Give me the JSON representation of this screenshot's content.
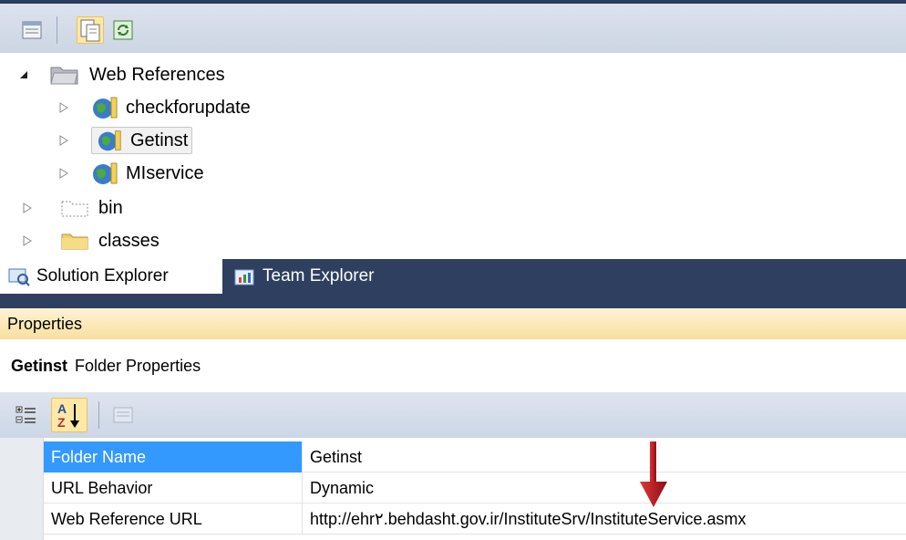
{
  "toolbar": {
    "buttons": [
      {
        "icon": "properties-view-icon",
        "active": false
      },
      {
        "icon": "show-all-files-icon",
        "active": true
      },
      {
        "icon": "refresh-icon",
        "active": false
      }
    ]
  },
  "tree": {
    "web_references": "Web References",
    "items": [
      "checkforupdate",
      "Getinst",
      "MIservice"
    ],
    "bin": "bin",
    "classes": "classes"
  },
  "tabs": {
    "solution_explorer": "Solution Explorer",
    "team_explorer": "Team Explorer"
  },
  "properties": {
    "title": "Properties",
    "object_name": "Getinst",
    "object_type": "Folder Properties",
    "rows": [
      {
        "name": "Folder Name",
        "value": "Getinst"
      },
      {
        "name": "URL Behavior",
        "value": "Dynamic"
      },
      {
        "name": "Web Reference URL",
        "value": "http://ehr۲.behdasht.gov.ir/InstituteSrv/InstituteService.asmx"
      }
    ]
  },
  "colors": {
    "accent_selection": "#3399ff",
    "tab_strip": "#2e3f60",
    "annotation_arrow": "#b3151a"
  }
}
